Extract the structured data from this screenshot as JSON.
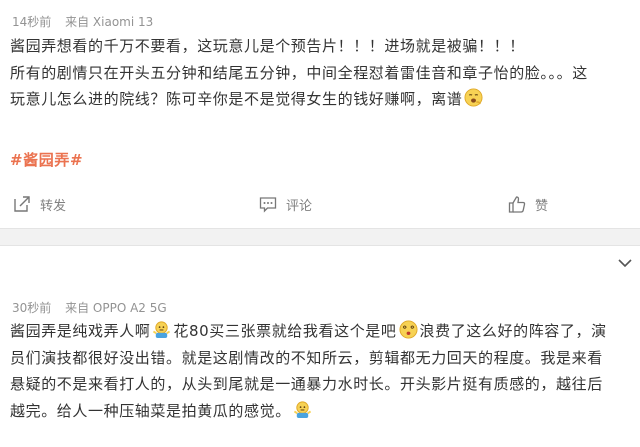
{
  "post1": {
    "time": "14秒前",
    "source": "来自 Xiaomi 13",
    "line1": "酱园弄想看的千万不要看，这玩意儿是个预告片！！！进场就是被骗！！！",
    "line2": "所有的剧情只在开头五分钟和结尾五分钟，中间全程怼着雷佳音和章子怡的脸。。。这",
    "line3": "玩意儿怎么进的院线？陈可辛你是不是觉得女生的钱好赚啊，离谱",
    "hashtag": "#酱园弄#",
    "actions": {
      "repost": "转发",
      "comment": "评论",
      "like": "赞"
    }
  },
  "post2": {
    "time": "30秒前",
    "source": "来自 OPPO A2 5G",
    "seg1": "酱园弄是纯戏弄人啊",
    "seg2": "花80买三张票就给我看这个是吧",
    "seg3": "浪费了这么好的阵容了，演",
    "line2": "员们演技都很好没出错。就是这剧情改的不知所云，剪辑都无力回天的程度。我是来看",
    "line3": "悬疑的不是来看打人的，从头到尾就是一通暴力水时长。开头影片挺有质感的，越往后",
    "line4": "越完。给人一种压轴菜是拍黄瓜的感觉。"
  },
  "icons": [
    "yawn-emoji-icon",
    "repost-icon",
    "comment-icon",
    "like-icon",
    "chevron-down-icon",
    "shrug-emoji-icon",
    "dizzy-emoji-icon"
  ],
  "colors": {
    "text": "#333333",
    "meta": "#939393",
    "hashtag": "#eb7350",
    "divider": "#f2f2f2"
  }
}
